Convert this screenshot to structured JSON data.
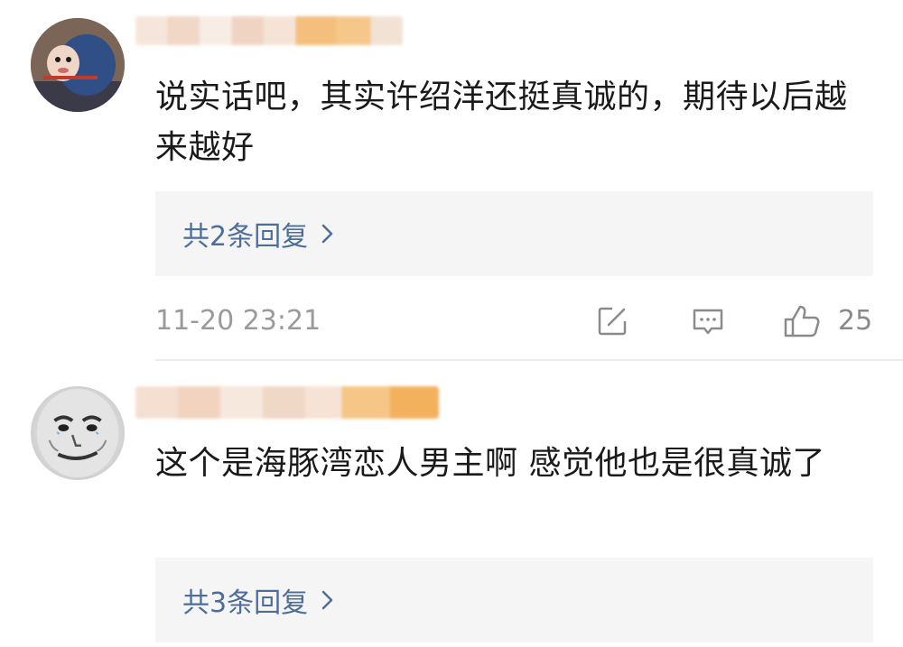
{
  "comments": [
    {
      "text": "说实话吧，其实许绍洋还挺真诚的，期待以后越来越好",
      "replies_label": "共2条回复",
      "timestamp": "11-20 23:21",
      "like_count": "25",
      "avatar_icon": "cartoon-character-avatar"
    },
    {
      "text": "这个是海豚湾恋人男主啊 感觉他也是很真诚了",
      "replies_label": "共3条回复",
      "avatar_icon": "meme-face-avatar"
    }
  ],
  "colors": {
    "reply_link": "#4d6e9a",
    "meta_text": "#9a9a9a",
    "reply_box_bg": "#f5f5f5"
  },
  "icons": {
    "share": "share-square-icon",
    "reply": "comment-bubble-icon",
    "like": "thumbs-up-icon",
    "chevron": "chevron-right-icon"
  }
}
